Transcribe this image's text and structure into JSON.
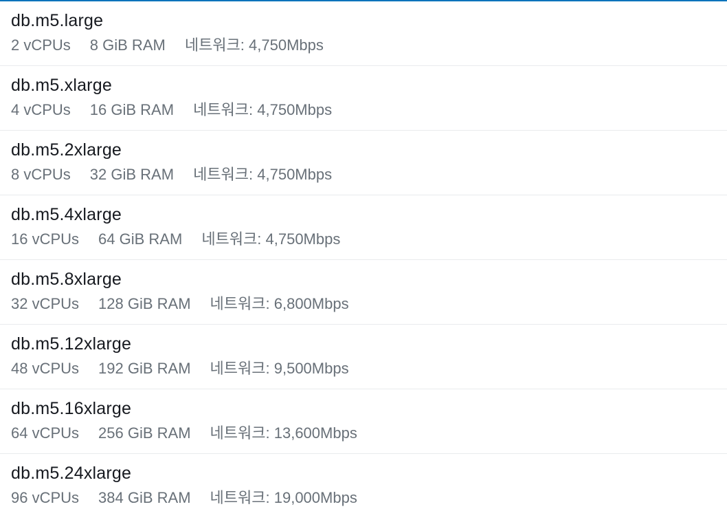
{
  "colors": {
    "accent": "#0073bb",
    "title_text": "#16191f",
    "secondary_text": "#687078",
    "divider": "#e9ebed"
  },
  "instance_options": [
    {
      "name": "db.m5.large",
      "vcpu": "2 vCPUs",
      "ram": "8 GiB RAM",
      "network": "네트워크: 4,750Mbps"
    },
    {
      "name": "db.m5.xlarge",
      "vcpu": "4 vCPUs",
      "ram": "16 GiB RAM",
      "network": "네트워크: 4,750Mbps"
    },
    {
      "name": "db.m5.2xlarge",
      "vcpu": "8 vCPUs",
      "ram": "32 GiB RAM",
      "network": "네트워크: 4,750Mbps"
    },
    {
      "name": "db.m5.4xlarge",
      "vcpu": "16 vCPUs",
      "ram": "64 GiB RAM",
      "network": "네트워크: 4,750Mbps"
    },
    {
      "name": "db.m5.8xlarge",
      "vcpu": "32 vCPUs",
      "ram": "128 GiB RAM",
      "network": "네트워크: 6,800Mbps"
    },
    {
      "name": "db.m5.12xlarge",
      "vcpu": "48 vCPUs",
      "ram": "192 GiB RAM",
      "network": "네트워크: 9,500Mbps"
    },
    {
      "name": "db.m5.16xlarge",
      "vcpu": "64 vCPUs",
      "ram": "256 GiB RAM",
      "network": "네트워크: 13,600Mbps"
    },
    {
      "name": "db.m5.24xlarge",
      "vcpu": "96 vCPUs",
      "ram": "384 GiB RAM",
      "network": "네트워크: 19,000Mbps"
    }
  ]
}
